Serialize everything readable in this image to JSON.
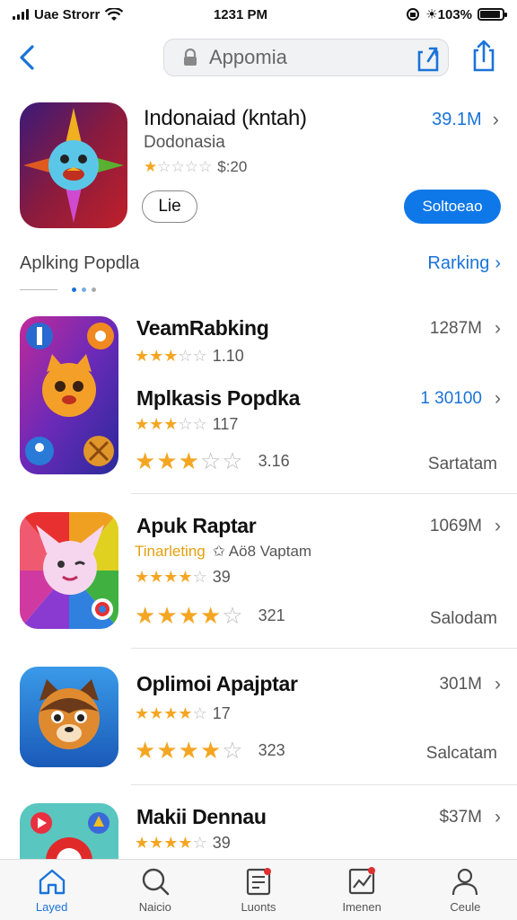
{
  "status_bar": {
    "carrier": "Uae Strorr",
    "time": "1231 PM",
    "battery_text": "☀103%",
    "battery_level": 0.9
  },
  "nav": {
    "url_text": "Appomia"
  },
  "hero": {
    "title": "Indonaiad (kntah)",
    "subtitle": "Dodonasia",
    "price": "$:20",
    "rating": 1,
    "size": "39.1M",
    "like_label": "Lie",
    "get_label": "Soltoeao"
  },
  "section": {
    "title": "Aplking Popdla",
    "link": "Rarking"
  },
  "items": [
    {
      "name": "VeamRabking",
      "size": "1287M",
      "rating": 3,
      "rating_text": "1.10",
      "sub_name": "Mplkasis Popdka",
      "sub_size": "1 30100",
      "sub_rating": 3,
      "sub_rating_text": "117",
      "big_rating": 3,
      "big_rating_text": "3.16",
      "status": "Sartatam"
    },
    {
      "name": "Apuk Raptar",
      "size": "1069M",
      "tagline": "Tinarleting",
      "tagline_extra": "✩ Aö8 Vaptam",
      "rating": 4,
      "rating_text": "39",
      "big_rating": 4,
      "big_rating_text": "321",
      "status": "Salodam"
    },
    {
      "name": "Oplimoi Apajptar",
      "size": "301M",
      "rating": 4,
      "rating_text": "17",
      "big_rating": 4,
      "big_rating_text": "323",
      "status": "Salcatam"
    },
    {
      "name": "Makii Dennau",
      "size": "$37M",
      "rating": 4,
      "rating_text": "39"
    }
  ],
  "tabs": [
    {
      "label": "Layed",
      "icon": "home-icon"
    },
    {
      "label": "Naicio",
      "icon": "search-icon"
    },
    {
      "label": "Luonts",
      "icon": "document-icon"
    },
    {
      "label": "Imenen",
      "icon": "chart-icon"
    },
    {
      "label": "Ceule",
      "icon": "person-icon"
    }
  ],
  "colors": {
    "accent": "#1a73d9",
    "star": "#f4a623",
    "get_button": "#0f78e8"
  }
}
